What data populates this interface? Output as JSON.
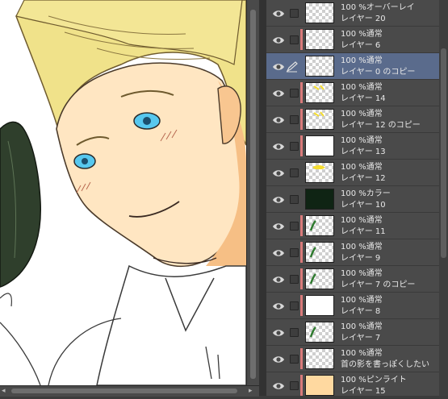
{
  "layers": [
    {
      "mode": "100 %オーバーレイ",
      "name": "レイヤー 20",
      "clip": false,
      "selected": false,
      "thumb": "checker",
      "tool": "eye"
    },
    {
      "mode": "100 %通常",
      "name": "レイヤー 6",
      "clip": true,
      "selected": false,
      "thumb": "checker",
      "tool": "eye"
    },
    {
      "mode": "100 %通常",
      "name": "レイヤー 0 のコピー",
      "clip": false,
      "selected": true,
      "thumb": "checker",
      "tool": "pencil"
    },
    {
      "mode": "100 %通常",
      "name": "レイヤー 14",
      "clip": true,
      "selected": false,
      "thumb": "yellow-strokes",
      "tool": "eye"
    },
    {
      "mode": "100 %通常",
      "name": "レイヤー 12 のコピー",
      "clip": true,
      "selected": false,
      "thumb": "yellow-strokes",
      "tool": "eye"
    },
    {
      "mode": "100 %通常",
      "name": "レイヤー 13",
      "clip": true,
      "selected": false,
      "thumb": "white",
      "tool": "eye"
    },
    {
      "mode": "100 %通常",
      "name": "レイヤー 12",
      "clip": false,
      "selected": false,
      "thumb": "yellow-blob",
      "tool": "eye"
    },
    {
      "mode": "100 %カラー",
      "name": "レイヤー 10",
      "clip": false,
      "selected": false,
      "thumb": "dark-green",
      "tool": "eye"
    },
    {
      "mode": "100 %通常",
      "name": "レイヤー 11",
      "clip": true,
      "selected": false,
      "thumb": "green-stroke",
      "tool": "eye"
    },
    {
      "mode": "100 %通常",
      "name": "レイヤー 9",
      "clip": true,
      "selected": false,
      "thumb": "green-stroke",
      "tool": "eye"
    },
    {
      "mode": "100 %通常",
      "name": "レイヤー 7 のコピー",
      "clip": true,
      "selected": false,
      "thumb": "green-stroke",
      "tool": "eye"
    },
    {
      "mode": "100 %通常",
      "name": "レイヤー 8",
      "clip": true,
      "selected": false,
      "thumb": "white",
      "tool": "eye"
    },
    {
      "mode": "100 %通常",
      "name": "レイヤー 7",
      "clip": false,
      "selected": false,
      "thumb": "green-stroke",
      "tool": "eye"
    },
    {
      "mode": "100 %通常",
      "name": "首の影を書っぽくしたい",
      "clip": true,
      "selected": false,
      "thumb": "checker",
      "tool": "eye"
    },
    {
      "mode": "100 %ピンライト",
      "name": "レイヤー 15",
      "clip": true,
      "selected": false,
      "thumb": "peach",
      "tool": "eye"
    }
  ],
  "colors": {
    "panel_bg": "#4a4a4a",
    "selected_row": "#5a6b8c",
    "clip_marker": "#d97a7a",
    "hair": "#f0e28a",
    "skin": "#ffe6c2",
    "skin_shadow": "#f6bf85",
    "glove": "#2f3f2c",
    "eye": "#57c8ef"
  }
}
